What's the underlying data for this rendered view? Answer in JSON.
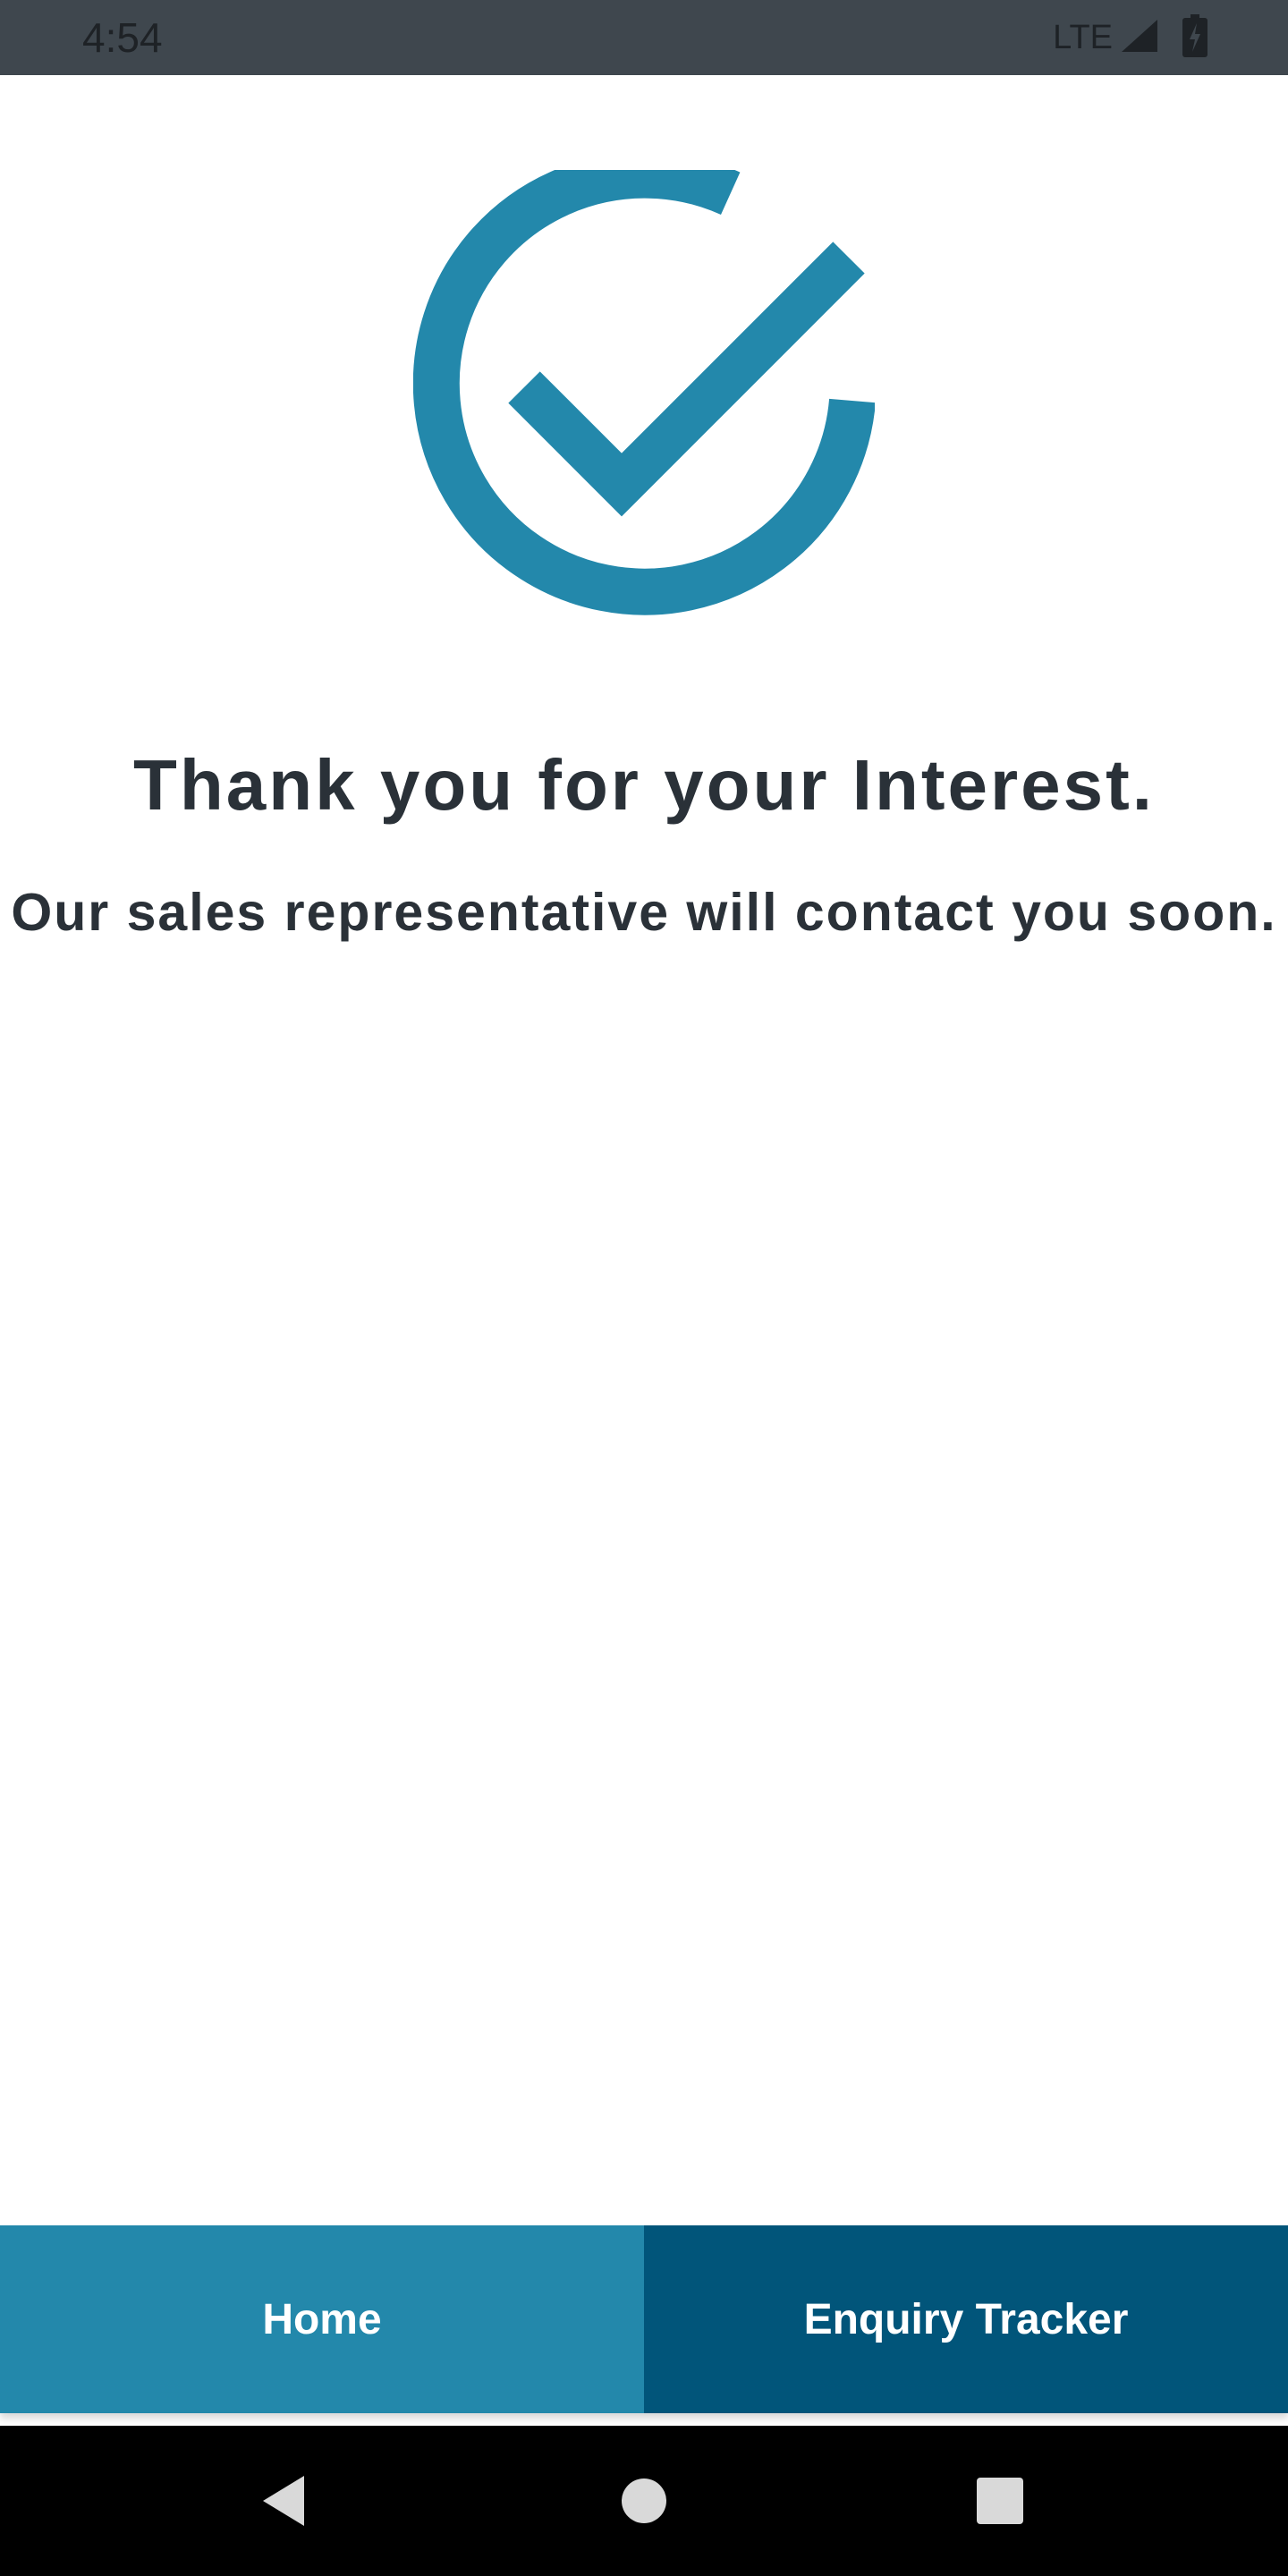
{
  "status_bar": {
    "time": "4:54",
    "network": "LTE",
    "icons": [
      "signal-icon",
      "battery-charging-icon"
    ]
  },
  "confirmation": {
    "icon": "check-circle-icon",
    "title": "Thank you for your Interest.",
    "message": "Our sales representative will contact you soon."
  },
  "actions": {
    "home_label": "Home",
    "tracker_label": "Enquiry Tracker"
  },
  "system_nav": {
    "icons": [
      "back-icon",
      "home-icon",
      "recents-icon"
    ]
  },
  "colors": {
    "accent": "#2388ab",
    "accent_dark": "#01557a",
    "text": "#2a3138",
    "status_bar": "#3f474e",
    "nav_bar": "#000000"
  }
}
